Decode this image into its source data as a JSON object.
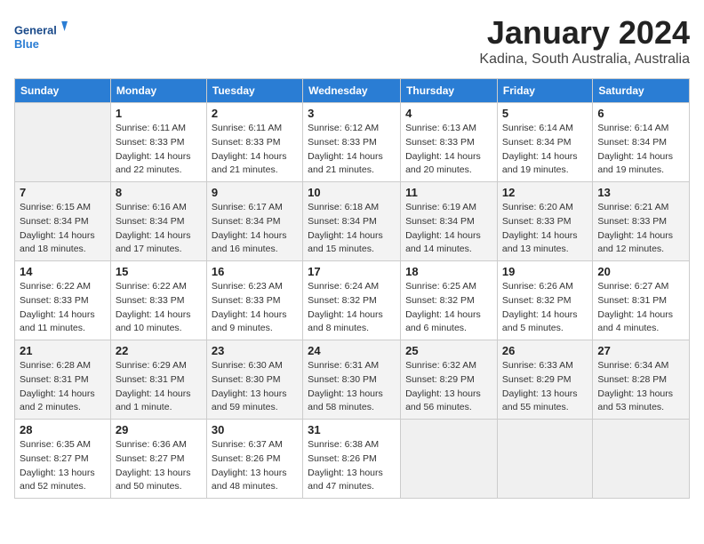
{
  "header": {
    "logo_line1": "General",
    "logo_line2": "Blue",
    "title": "January 2024",
    "location": "Kadina, South Australia, Australia"
  },
  "calendar": {
    "weekdays": [
      "Sunday",
      "Monday",
      "Tuesday",
      "Wednesday",
      "Thursday",
      "Friday",
      "Saturday"
    ],
    "weeks": [
      [
        {
          "day": "",
          "info": ""
        },
        {
          "day": "1",
          "info": "Sunrise: 6:11 AM\nSunset: 8:33 PM\nDaylight: 14 hours\nand 22 minutes."
        },
        {
          "day": "2",
          "info": "Sunrise: 6:11 AM\nSunset: 8:33 PM\nDaylight: 14 hours\nand 21 minutes."
        },
        {
          "day": "3",
          "info": "Sunrise: 6:12 AM\nSunset: 8:33 PM\nDaylight: 14 hours\nand 21 minutes."
        },
        {
          "day": "4",
          "info": "Sunrise: 6:13 AM\nSunset: 8:33 PM\nDaylight: 14 hours\nand 20 minutes."
        },
        {
          "day": "5",
          "info": "Sunrise: 6:14 AM\nSunset: 8:34 PM\nDaylight: 14 hours\nand 19 minutes."
        },
        {
          "day": "6",
          "info": "Sunrise: 6:14 AM\nSunset: 8:34 PM\nDaylight: 14 hours\nand 19 minutes."
        }
      ],
      [
        {
          "day": "7",
          "info": "Sunrise: 6:15 AM\nSunset: 8:34 PM\nDaylight: 14 hours\nand 18 minutes."
        },
        {
          "day": "8",
          "info": "Sunrise: 6:16 AM\nSunset: 8:34 PM\nDaylight: 14 hours\nand 17 minutes."
        },
        {
          "day": "9",
          "info": "Sunrise: 6:17 AM\nSunset: 8:34 PM\nDaylight: 14 hours\nand 16 minutes."
        },
        {
          "day": "10",
          "info": "Sunrise: 6:18 AM\nSunset: 8:34 PM\nDaylight: 14 hours\nand 15 minutes."
        },
        {
          "day": "11",
          "info": "Sunrise: 6:19 AM\nSunset: 8:34 PM\nDaylight: 14 hours\nand 14 minutes."
        },
        {
          "day": "12",
          "info": "Sunrise: 6:20 AM\nSunset: 8:33 PM\nDaylight: 14 hours\nand 13 minutes."
        },
        {
          "day": "13",
          "info": "Sunrise: 6:21 AM\nSunset: 8:33 PM\nDaylight: 14 hours\nand 12 minutes."
        }
      ],
      [
        {
          "day": "14",
          "info": "Sunrise: 6:22 AM\nSunset: 8:33 PM\nDaylight: 14 hours\nand 11 minutes."
        },
        {
          "day": "15",
          "info": "Sunrise: 6:22 AM\nSunset: 8:33 PM\nDaylight: 14 hours\nand 10 minutes."
        },
        {
          "day": "16",
          "info": "Sunrise: 6:23 AM\nSunset: 8:33 PM\nDaylight: 14 hours\nand 9 minutes."
        },
        {
          "day": "17",
          "info": "Sunrise: 6:24 AM\nSunset: 8:32 PM\nDaylight: 14 hours\nand 8 minutes."
        },
        {
          "day": "18",
          "info": "Sunrise: 6:25 AM\nSunset: 8:32 PM\nDaylight: 14 hours\nand 6 minutes."
        },
        {
          "day": "19",
          "info": "Sunrise: 6:26 AM\nSunset: 8:32 PM\nDaylight: 14 hours\nand 5 minutes."
        },
        {
          "day": "20",
          "info": "Sunrise: 6:27 AM\nSunset: 8:31 PM\nDaylight: 14 hours\nand 4 minutes."
        }
      ],
      [
        {
          "day": "21",
          "info": "Sunrise: 6:28 AM\nSunset: 8:31 PM\nDaylight: 14 hours\nand 2 minutes."
        },
        {
          "day": "22",
          "info": "Sunrise: 6:29 AM\nSunset: 8:31 PM\nDaylight: 14 hours\nand 1 minute."
        },
        {
          "day": "23",
          "info": "Sunrise: 6:30 AM\nSunset: 8:30 PM\nDaylight: 13 hours\nand 59 minutes."
        },
        {
          "day": "24",
          "info": "Sunrise: 6:31 AM\nSunset: 8:30 PM\nDaylight: 13 hours\nand 58 minutes."
        },
        {
          "day": "25",
          "info": "Sunrise: 6:32 AM\nSunset: 8:29 PM\nDaylight: 13 hours\nand 56 minutes."
        },
        {
          "day": "26",
          "info": "Sunrise: 6:33 AM\nSunset: 8:29 PM\nDaylight: 13 hours\nand 55 minutes."
        },
        {
          "day": "27",
          "info": "Sunrise: 6:34 AM\nSunset: 8:28 PM\nDaylight: 13 hours\nand 53 minutes."
        }
      ],
      [
        {
          "day": "28",
          "info": "Sunrise: 6:35 AM\nSunset: 8:27 PM\nDaylight: 13 hours\nand 52 minutes."
        },
        {
          "day": "29",
          "info": "Sunrise: 6:36 AM\nSunset: 8:27 PM\nDaylight: 13 hours\nand 50 minutes."
        },
        {
          "day": "30",
          "info": "Sunrise: 6:37 AM\nSunset: 8:26 PM\nDaylight: 13 hours\nand 48 minutes."
        },
        {
          "day": "31",
          "info": "Sunrise: 6:38 AM\nSunset: 8:26 PM\nDaylight: 13 hours\nand 47 minutes."
        },
        {
          "day": "",
          "info": ""
        },
        {
          "day": "",
          "info": ""
        },
        {
          "day": "",
          "info": ""
        }
      ]
    ]
  }
}
